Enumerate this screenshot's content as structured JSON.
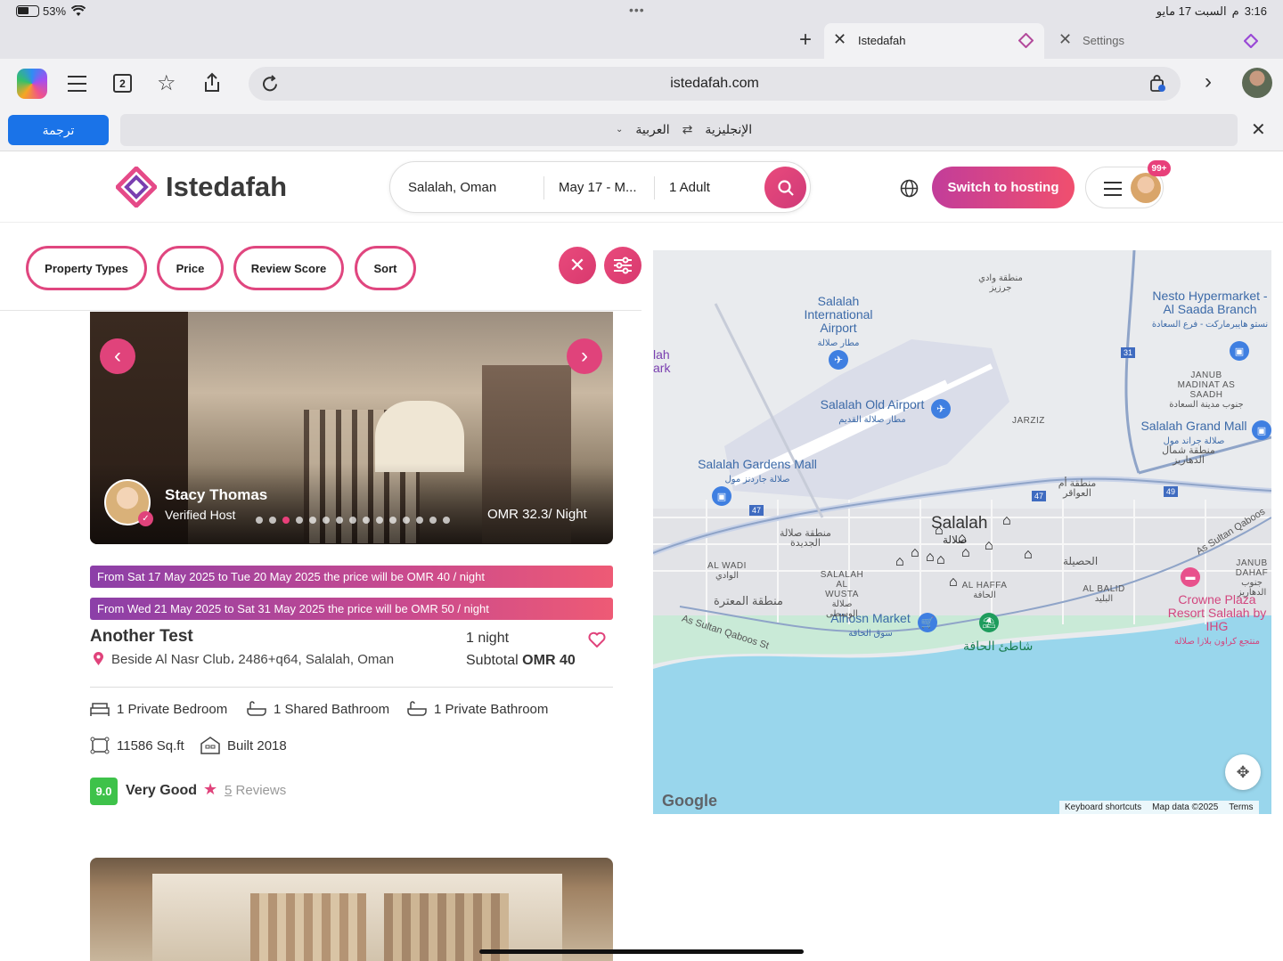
{
  "status": {
    "battery": "53%",
    "time": "3:16",
    "date_ar": "السبت 17 مايو",
    "ampm_ar": "م",
    "dots": "•••"
  },
  "tabs": [
    {
      "label": "Istedafah"
    },
    {
      "label": "Settings"
    }
  ],
  "toolbar": {
    "tab_count": "2",
    "url": "istedafah.com"
  },
  "translate": {
    "button": "ترجمة",
    "from": "الإنجليزية",
    "to": "العربية"
  },
  "header": {
    "logo": "Istedafah",
    "search": {
      "location": "Salalah, Oman",
      "dates": "May 17 - M...",
      "guests": "1 Adult"
    },
    "switch_hosting": "Switch to hosting",
    "notif_badge": "99+"
  },
  "filters": [
    "Property Types",
    "Price",
    "Review Score",
    "Sort"
  ],
  "listing": {
    "host_name": "Stacy Thomas",
    "host_status": "Verified Host",
    "photo_price": "OMR 32.3/ Night",
    "banners": [
      "From Sat 17 May 2025 to Tue 20 May 2025 the price will be OMR 40 / night",
      "From Wed 21 May 2025 to Sat 31 May 2025 the price will be OMR 50 / night"
    ],
    "title": "Another Test",
    "address": "Beside Al Nasr Club، 2486+q64, Salalah, Oman",
    "nights": "1 night",
    "subtotal_label": "Subtotal",
    "subtotal_value": "OMR 40",
    "amenities": [
      "1 Private Bedroom",
      "1 Shared Bathroom",
      "1 Private Bathroom",
      "11586 Sq.ft",
      "Built 2018"
    ],
    "score": "9.0",
    "score_text": "Very Good",
    "reviews_count": "5",
    "reviews_label": "Reviews"
  },
  "map": {
    "labels": {
      "airport": "Salalah International Airport",
      "airport_ar": "مطار صلالة",
      "old_airport": "Salalah Old Airport",
      "old_airport_ar": "مطار صلالة القديم",
      "gardens_mall": "Salalah Gardens Mall",
      "gardens_mall_ar": "صلالة جاردنز مول",
      "nesto": "Nesto Hypermarket - Al Saada Branch",
      "nesto_ar": "نستو هايبرماركت - فرع السعادة",
      "grand_mall": "Salalah Grand Mall",
      "grand_mall_ar": "صلالة جراند مول",
      "salalah": "Salalah",
      "salalah_ar": "صلالة",
      "alhosn": "Alhosn Market",
      "alhosn_ar": "سوق الحافة",
      "beach_ar": "شاطئ الحافة",
      "crowne": "Crowne Plaza Resort Salalah by IHG",
      "crowne_ar": "منتجع كراون بلازا صلالة",
      "jarziz": "JARZIZ",
      "al_wadi": "AL WADI",
      "al_wadi_ar": "الوادي",
      "salalah_wusta": "SALALAH AL WUSTA",
      "salalah_wusta_ar": "صلالة الوسطى",
      "al_haffa": "AL HAFFA",
      "al_haffa_ar": "الحافة",
      "al_balid": "AL BALID",
      "al_balid_ar": "البليد",
      "janub_madinat": "JANUB MADINAT AS SAADH",
      "janub_madinat_ar": "جنوب مدينة السعادة",
      "janub_dahariz": "JANUB DAHAF",
      "janub_dahariz_ar": "جنوب الدهاريز",
      "dahariz_north_ar": "منطقة شمال الدهاريز",
      "new_salalah_ar": "منطقة صلالة الجديدة",
      "mutaza_ar": "منطقة المعترة",
      "husayla_ar": "الحصيلة",
      "awaqir_ar": "منطقة أم العواقر",
      "wadi_jarzeez_ar": "منطقة وادي جرزيز",
      "sultan_qaboos_1": "As Sultan Qaboos St",
      "sultan_qaboos_2": "As Sultan Qaboos",
      "park": "lah ark",
      "route_31": "31",
      "route_47a": "47",
      "route_47b": "47",
      "route_49": "49"
    },
    "attribution": {
      "google": "Google",
      "shortcuts": "Keyboard shortcuts",
      "data": "Map data ©2025",
      "terms": "Terms"
    }
  }
}
